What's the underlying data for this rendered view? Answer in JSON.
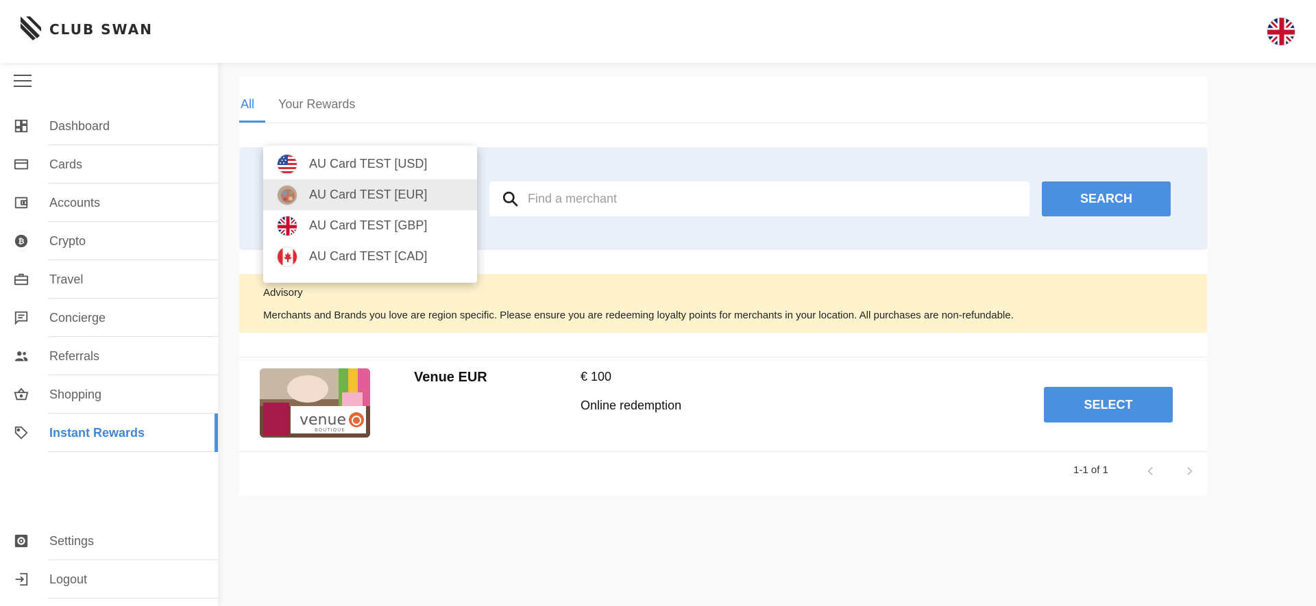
{
  "brand": {
    "name": "CLUB SWAN"
  },
  "header": {
    "language_flag": "uk-flag-icon"
  },
  "sidebar": {
    "items": [
      {
        "label": "Dashboard",
        "icon": "dashboard-icon"
      },
      {
        "label": "Cards",
        "icon": "credit-card-icon"
      },
      {
        "label": "Accounts",
        "icon": "wallet-icon"
      },
      {
        "label": "Crypto",
        "icon": "bitcoin-icon"
      },
      {
        "label": "Travel",
        "icon": "briefcase-icon"
      },
      {
        "label": "Concierge",
        "icon": "chat-icon"
      },
      {
        "label": "Referrals",
        "icon": "people-icon"
      },
      {
        "label": "Shopping",
        "icon": "basket-icon"
      },
      {
        "label": "Instant Rewards",
        "icon": "tag-icon",
        "active": true
      }
    ],
    "bottom_items": [
      {
        "label": "Settings",
        "icon": "settings-icon"
      },
      {
        "label": "Logout",
        "icon": "logout-icon"
      }
    ]
  },
  "tabs": [
    {
      "label": "All",
      "active": true
    },
    {
      "label": "Your Rewards"
    }
  ],
  "card_dropdown": {
    "options": [
      {
        "label": "AU Card TEST [USD]",
        "flag": "us-flag-icon"
      },
      {
        "label": "AU Card TEST [EUR]",
        "flag": "eu-flag-icon",
        "selected": true
      },
      {
        "label": "AU Card TEST [GBP]",
        "flag": "uk-flag-icon"
      },
      {
        "label": "AU Card TEST [CAD]",
        "flag": "ca-flag-icon"
      }
    ]
  },
  "search": {
    "placeholder": "Find a merchant",
    "button_label": "SEARCH"
  },
  "advisory": {
    "title": "Advisory",
    "text": "Merchants and Brands you love are region specific. Please ensure you are redeeming loyalty points for merchants in your location. All purchases are non-refundable."
  },
  "rewards": [
    {
      "name": "Venue EUR",
      "price": "€ 100",
      "redemption": "Online redemption",
      "button_label": "SELECT",
      "logo_text": "venue",
      "logo_sub": "BOUTIQUE"
    }
  ],
  "pagination": {
    "info": "1-1 of 1"
  },
  "colors": {
    "accent": "#4a8fe0",
    "advisory_bg": "#fff3cd",
    "search_panel_bg": "#e9f0f9"
  }
}
